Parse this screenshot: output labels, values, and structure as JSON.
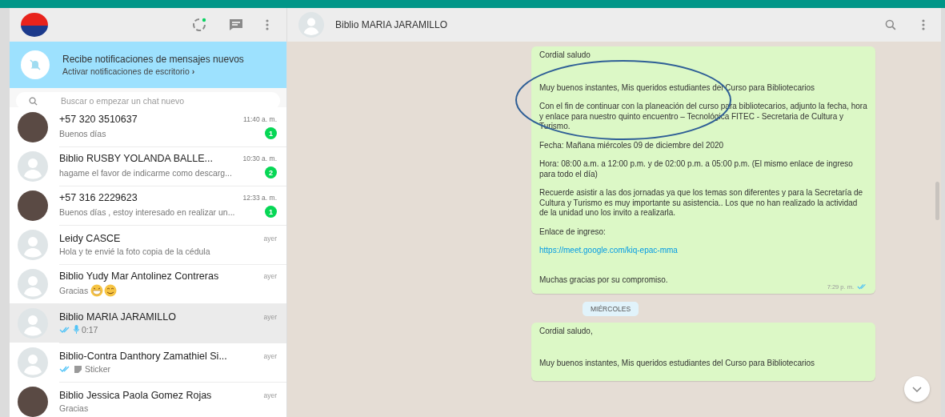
{
  "sidebar": {
    "header": {
      "icons": [
        {
          "kind": "status"
        },
        {
          "kind": "new-chat"
        },
        {
          "kind": "menu"
        }
      ]
    },
    "banner": {
      "title": "Recibe notificaciones de mensajes nuevos",
      "link": "Activar notificaciones de escritorio",
      "chevron": "›"
    },
    "search": {
      "placeholder": "Buscar o empezar un chat nuevo"
    },
    "chats": [
      {
        "name": "+57 320 3510637",
        "time": "11:40 a. m.",
        "preview": "Buenos días",
        "unread": "1",
        "avatar": {
          "kind": "photo"
        },
        "selected": false
      },
      {
        "name": "Biblio RUSBY YOLANDA BALLE...",
        "time": "10:30 a. m.",
        "preview": "hagame el favor de indicarme como descarg...",
        "unread": "2",
        "avatar": {
          "kind": "default"
        },
        "selected": false
      },
      {
        "name": "+57 316 2229623",
        "time": "12:33 a. m.",
        "preview": "Buenos días , estoy interesado en realizar un...",
        "unread": "1",
        "avatar": {
          "kind": "photo"
        },
        "selected": false
      },
      {
        "name": "Leidy CASCE",
        "time": "ayer",
        "preview": "Hola y te envié la foto copia de la cédula",
        "avatar": {
          "kind": "default"
        },
        "selected": false
      },
      {
        "name": "Biblio Yudy Mar Antolinez Contreras",
        "time": "ayer",
        "preview": "Gracias",
        "preview_icon": {
          "kind": "emoji"
        },
        "avatar": {
          "kind": "default"
        },
        "selected": false
      },
      {
        "name": "Biblio MARIA JARAMILLO",
        "time": "ayer",
        "preview": "0:17",
        "read_ticks": true,
        "preview_icon": {
          "kind": "mic"
        },
        "avatar": {
          "kind": "default"
        },
        "selected": true
      },
      {
        "name": "Biblio-Contra Danthory Zamathiel Si...",
        "time": "ayer",
        "preview": "Sticker",
        "read_ticks": true,
        "preview_icon": {
          "kind": "sticker"
        },
        "avatar": {
          "kind": "default"
        },
        "selected": false
      },
      {
        "name": "Biblio Jessica Paola Gomez Rojas",
        "time": "ayer",
        "preview": "Gracias",
        "avatar": {
          "kind": "photo"
        },
        "selected": false
      }
    ]
  },
  "chat": {
    "title": "Biblio MARIA JARAMILLO",
    "messages": [
      {
        "kind": "message",
        "time": "7:29 p. m.",
        "read_ticks": true,
        "paragraphs": [
          {
            "kind": "text",
            "text": "Cordial saludo"
          },
          {
            "kind": "text",
            "text": "Muy buenos instantes, Mis queridos estudiantes del Curso para Bibliotecarios"
          },
          {
            "kind": "text",
            "text": "Con el fin de continuar con la planeación del curso para bibliotecarios, adjunto la fecha, hora y enlace para nuestro quinto encuentro – Tecnológica FITEC - Secretaria de Cultura y Turismo."
          },
          {
            "kind": "text",
            "text": "Fecha: Mañana miércoles 09 de diciembre del 2020"
          },
          {
            "kind": "text",
            "text": "Hora:  08:00 a.m. a 12:00 p.m. y de 02:00 p.m. a 05:00 p.m. (El mismo enlace de ingreso para todo el día)"
          },
          {
            "kind": "text",
            "text": "Recuerde asistir a las dos jornadas ya que los temas son diferentes y para la Secretaría de Cultura y Turismo es muy importante su asistencia.. Los que no han realizado la actividad de la unidad uno los invito a realizarla."
          },
          {
            "kind": "text",
            "text": "Enlace de ingreso:"
          },
          {
            "kind": "link",
            "text": "https://meet.google.com/kiq-epac-mma"
          },
          {
            "kind": "text",
            "text": "Muchas gracias por su compromiso."
          }
        ]
      },
      {
        "kind": "day",
        "text": "MIÉRCOLES"
      },
      {
        "kind": "message",
        "paragraphs": [
          {
            "kind": "text",
            "text": "Cordial saludo,"
          },
          {
            "kind": "text",
            "text": "Muy buenos instantes, Mis queridos estudiantes del Curso para Bibliotecarios"
          }
        ]
      }
    ]
  }
}
